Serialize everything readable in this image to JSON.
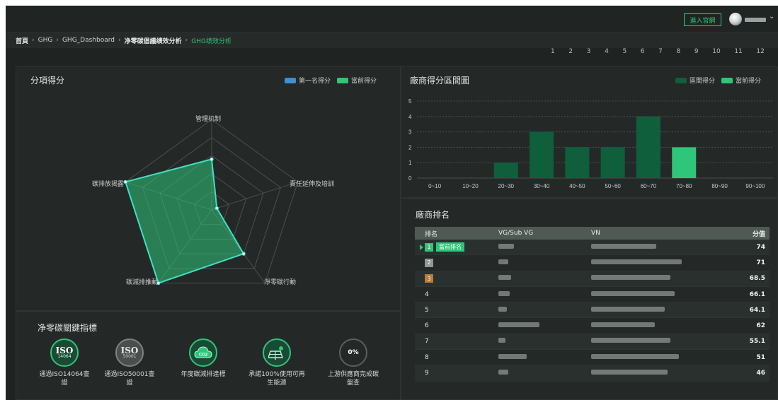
{
  "header": {
    "enter_button": "進入官網"
  },
  "breadcrumb": [
    "首頁",
    "GHG",
    "GHG_Dashboard",
    "净零碳倡議绩效分析",
    "GHG绩效分析"
  ],
  "pager": [
    "1",
    "2",
    "3",
    "4",
    "5",
    "6",
    "7",
    "8",
    "9",
    "10",
    "11",
    "12"
  ],
  "radar_panel": {
    "title": "分項得分",
    "legend": [
      "第一名得分",
      "當前得分"
    ],
    "colors": {
      "first": "#3f8fd6",
      "current": "#2fc57a"
    },
    "axes": [
      "管理机制",
      "責任延伸及培訓",
      "淨零碳行動",
      "碳減排推動",
      "碳排放揭露"
    ],
    "chart_data": {
      "type": "radar",
      "axes": [
        "管理机制",
        "責任延伸及培訓",
        "淨零碳行動",
        "碳減排推動",
        "碳排放揭露"
      ],
      "max": 5,
      "series": [
        {
          "name": "當前得分",
          "values": [
            2.8,
            0.3,
            3.0,
            5.0,
            5.0
          ]
        }
      ]
    }
  },
  "kpi_panel": {
    "title": "净零碳關鍵指標",
    "items": [
      {
        "label": "通過ISO14064查證",
        "icon": "iso-14064-icon",
        "badge": "ISO",
        "sub": "14064"
      },
      {
        "label": "通過ISO50001查證",
        "icon": "iso-50001-icon",
        "badge": "ISO",
        "sub": "50001"
      },
      {
        "label": "年度碳減排達標",
        "icon": "co2-cloud-icon",
        "badge": "CO2",
        "sub": ""
      },
      {
        "label": "承諾100%使用可再生能源",
        "icon": "solar-panel-icon",
        "badge": "",
        "sub": ""
      },
      {
        "label": "上游供應商完成碳盤查",
        "icon": "progress-ring-icon",
        "badge": "0%",
        "sub": ""
      }
    ]
  },
  "bar_panel": {
    "title": "廠商得分區間圖",
    "legend": [
      "區間得分",
      "當前得分"
    ],
    "colors": {
      "interval": "#0f5f3c",
      "current": "#2fc57a"
    },
    "chart_data": {
      "type": "bar",
      "categories": [
        "0~10",
        "10~20",
        "20~30",
        "30~40",
        "40~50",
        "50~60",
        "60~70",
        "70~80",
        "80~90",
        "90~100"
      ],
      "values": [
        0,
        0,
        1,
        3,
        2,
        2,
        4,
        2,
        0,
        0
      ],
      "current_category": "70~80",
      "ylim": [
        0,
        5
      ],
      "yticks": [
        "0",
        "1",
        "2",
        "3",
        "4",
        "5"
      ]
    }
  },
  "ranking": {
    "title": "廠商排名",
    "columns": [
      "排名",
      "VG/Sub VG",
      "VN",
      "分值"
    ],
    "current_tag": "當前排名",
    "rows": [
      {
        "rank": "1",
        "score": "74",
        "vg_w": 22,
        "vn_w": 92,
        "badge": "#2fc57a",
        "current": true
      },
      {
        "rank": "2",
        "score": "71",
        "vg_w": 14,
        "vn_w": 128,
        "badge": "#8e9896",
        "current": false
      },
      {
        "rank": "3",
        "score": "68.5",
        "vg_w": 18,
        "vn_w": 112,
        "badge": "#b87b3a",
        "current": false
      },
      {
        "rank": "4",
        "score": "66.1",
        "vg_w": 16,
        "vn_w": 118,
        "badge": "",
        "current": false
      },
      {
        "rank": "5",
        "score": "64.1",
        "vg_w": 12,
        "vn_w": 104,
        "badge": "",
        "current": false
      },
      {
        "rank": "6",
        "score": "62",
        "vg_w": 58,
        "vn_w": 90,
        "badge": "",
        "current": false
      },
      {
        "rank": "7",
        "score": "55.1",
        "vg_w": 10,
        "vn_w": 112,
        "badge": "",
        "current": false
      },
      {
        "rank": "8",
        "score": "51",
        "vg_w": 40,
        "vn_w": 124,
        "badge": "",
        "current": false
      },
      {
        "rank": "9",
        "score": "46",
        "vg_w": 14,
        "vn_w": 108,
        "badge": "",
        "current": false
      }
    ]
  }
}
